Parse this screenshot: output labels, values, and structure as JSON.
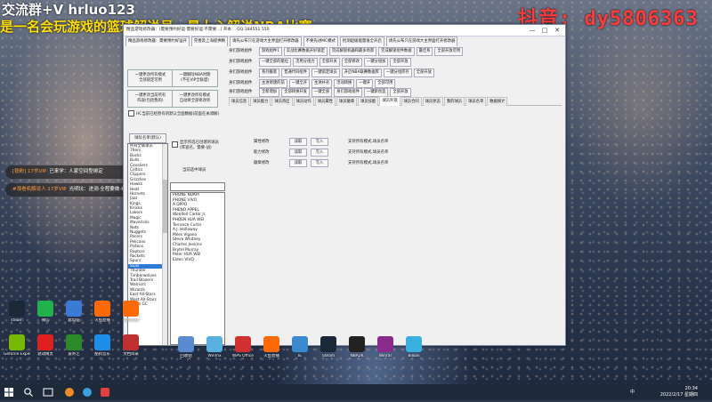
{
  "overlay": {
    "line1": "交流群+V hrluo123",
    "line2": "是一名会玩游戏的篮球解说员，最上心解说NBA比赛",
    "douyin": "抖音: dy5806363"
  },
  "chat": [
    {
      "name": "[铁粉] 17岁VIP",
      "text": "已来学：人家空间型绑定"
    },
    {
      "name": "#观看机解说人 17岁VIP",
      "text": "光明坑：进测·全程要做·看比赛"
    }
  ],
  "window": {
    "title": "精品游戏修改器：(需要预约好运·需要好运·不需要...)  开本：   QQ:184551 550",
    "min": "—",
    "max": "□",
    "close": "✕",
    "toolbar_buttons": [
      "精品游戏修改器：需要预约好运开",
      "完善及上海提供精",
      "请先公布只在游戏大主界面打开修改器",
      "不要先进MC模式",
      "检测超级能量值全开启",
      "请先公布只在游戏大主界面打开修改器"
    ]
  },
  "left": {
    "btn_change_left": "一键更改所有模式\n全部锁定可用",
    "btn_hire_left": "一键解除NBA时期\n(不在VIP全联盟)",
    "btn_change_right": "一键更改当前所有\n阵容(包括我的)",
    "btn_hire_right": "一键更改所有模式\n自动将全部修改项",
    "cb_hide": "HC当前已经原有的默认全面数据(前面在关调解)",
    "teams_button": "球队名单(默认)",
    "cb_sel": "显示所选已创建的球员(阵容名，需要-战)",
    "teams": [
      "所有全联球员",
      "76ers",
      "Bucks",
      "Bulls",
      "Cavaliers",
      "Celtics",
      "Clippers",
      "Grizzlies",
      "Hawks",
      "Heat",
      "Hornets",
      "Jazz",
      "Kings",
      "Knicks",
      "Lakers",
      "Magic",
      "Mavericks",
      "Nets",
      "Nuggets",
      "Pacers",
      "Pelicans",
      "Pistons",
      "Raptors",
      "Rockets",
      "Spurs",
      "Suns",
      "Thunder",
      "Timberwolves",
      "Trail Blazers",
      "Warriors",
      "Wizards",
      "East All-Stars",
      "West All-Stars",
      "76ers GC"
    ],
    "selected_team_index": 25,
    "current_label": "当前选中球员",
    "players": [
      "PHONE NOKIA",
      "PHONE VIVO",
      "A OPPO",
      "PHENO APPEL",
      "Wendell Carter Jr.",
      "PHOEN HUA WEI",
      "Terrance Curtis",
      "A.J. Holloway",
      "Miles Vigano",
      "Steve Whitney",
      "Charles Jenkins",
      "Brytel Murray",
      "Peter HUA WEI",
      "Elden VIVO"
    ]
  },
  "right": {
    "rows": [
      {
        "label": "身们游戏组件",
        "buttons": [
          "游戏组件1",
          "实战比赛数据开好锁定",
          "完成解锁机器和最多场景",
          "完成解锁组件数据",
          "最佳系",
          "全部开放可用"
        ]
      },
      {
        "label": "身们游戏组件",
        "buttons": [
          "一键全部的能位",
          "活用分组力",
          "全部开关",
          "全部修改",
          "一键分组加",
          "全部开放"
        ]
      },
      {
        "label": "身们游戏组件",
        "buttons": [
          "系列服装",
          "普通代码组件",
          "一键锁定球员",
          "开启NBA联赛数据库",
          "一键分组库存",
          "全部开放"
        ]
      },
      {
        "label": "身们游戏组件",
        "buttons": [
          "主进修建的前",
          " 一键全开",
          "主进补名",
          "活动转换",
          "一键开",
          "全部可用"
        ]
      },
      {
        "label": "身们游戏组件",
        "buttons": [
          "全新增加",
          "全部转换开发",
          "一键全部",
          "身们游戏组件",
          "一键新创造",
          "全部开放"
        ]
      }
    ],
    "tabs": [
      "球员信息",
      "球员能力",
      "球员热区",
      "球员动作",
      "球员属性",
      "球员徽章",
      "球员技能",
      "球员外观",
      "球员合同",
      "球员状态",
      "我的球员",
      "球员名单",
      "数据统计"
    ],
    "active_tab": 7,
    "fields": [
      {
        "label": "属性修改",
        "b1": "读取",
        "b2": "写入",
        "note": "支持所有模式,球员名单"
      },
      {
        "label": "能力修改",
        "b1": "读取",
        "b2": "写入",
        "note": "支持所有模式,球员名单"
      },
      {
        "label": "徽章修改",
        "b1": "读取",
        "b2": "写入",
        "note": "支持所有模式,球员名单"
      }
    ]
  },
  "desktop_icons": [
    {
      "label": "steam",
      "color": "#1b2838"
    },
    {
      "label": "微信",
      "color": "#22b14c"
    },
    {
      "label": "此电脑",
      "color": "#3a7bd5"
    },
    {
      "label": "火鱼直播",
      "color": "#ff6a00"
    },
    {
      "label": "火鱼直播",
      "color": "#ff6a00"
    },
    {
      "label": "Geforce\nExperience",
      "color": "#76b900"
    },
    {
      "label": "驱动精灵",
      "color": "#e02020"
    },
    {
      "label": "爱奇艺",
      "color": "#2a8a2a"
    },
    {
      "label": "酷狗音乐",
      "color": "#1e8ee8"
    },
    {
      "label": "文档目录",
      "color": "#c03030"
    },
    {
      "label": "回收站",
      "color": "#5a8ad0"
    },
    {
      "label": "Winmx",
      "color": "#5ab0e0"
    },
    {
      "label": "WPS Office",
      "color": "#d03030"
    },
    {
      "label": "火鱼直播",
      "color": "#ff6a00"
    },
    {
      "label": "IE",
      "color": "#3a8ad0"
    },
    {
      "label": "Steam",
      "color": "#1b2838"
    },
    {
      "label": "NBA2K",
      "color": "#222"
    },
    {
      "label": "Winrar",
      "color": "#8a2a8a"
    },
    {
      "label": "Bilibili",
      "color": "#3ab0e0"
    }
  ],
  "taskbar": {
    "time": "20:34",
    "date": "2022/2/17 星期四",
    "lang": "中"
  }
}
